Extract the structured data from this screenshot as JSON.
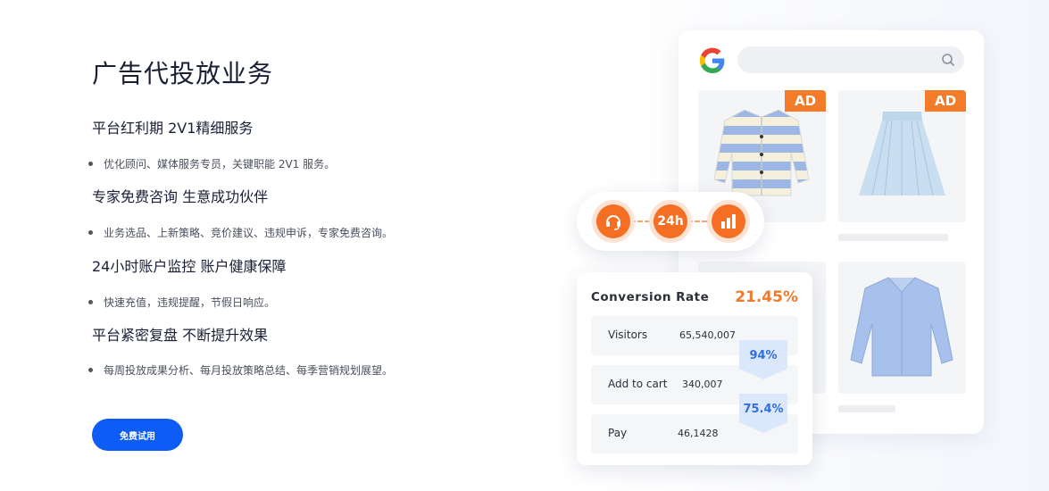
{
  "page": {
    "title": "广告代投放业务",
    "sections": [
      {
        "heading": "平台红利期 2V1精细服务",
        "bullet": "优化顾问、媒体服务专员，关键职能 2V1 服务。"
      },
      {
        "heading": "专家免费咨询 生意成功伙伴",
        "bullet": "业务选品、上新策略、竞价建议、违规申诉，专家免费咨询。"
      },
      {
        "heading": "24小时账户监控 账户健康保障",
        "bullet": "快速充值，违规提醒，节假日响应。"
      },
      {
        "heading": "平台紧密复盘 不断提升效果",
        "bullet": "每周投放成果分析、每月投放策略总结、每季营销规划展望。"
      }
    ],
    "cta_label": "免费试用"
  },
  "illustration": {
    "ad_badge": "AD",
    "pill_icon_24h": "24h",
    "icons": [
      "headset-icon",
      "clock-24h-icon",
      "bar-chart-icon",
      "search-icon",
      "google-logo"
    ],
    "conversion": {
      "title": "Conversion Rate",
      "rate": "21.45%",
      "rows": [
        {
          "label": "Visitors",
          "value": "65,540,007"
        },
        {
          "label": "Add to cart",
          "value": "340,007"
        },
        {
          "label": "Pay",
          "value": "46,1428"
        }
      ],
      "steps": [
        "94%",
        "75.4%"
      ]
    }
  },
  "colors": {
    "accent_orange": "#f47b2a",
    "cta_blue": "#0d5cf5",
    "step_blue": "#2f6fe0"
  }
}
